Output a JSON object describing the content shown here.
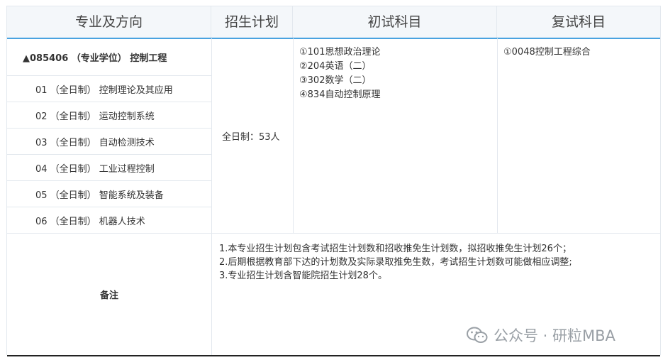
{
  "header": {
    "col1": "专业及方向",
    "col2": "招生计划",
    "col3": "初试科目",
    "col4": "复试科目"
  },
  "major": {
    "title": "▲085406 （专业学位） 控制工程"
  },
  "directions": [
    "01 （全日制） 控制理论及其应用",
    "02 （全日制） 运动控制系统",
    "03 （全日制） 自动检测技术",
    "04 （全日制） 工业过程控制",
    "05 （全日制） 智能系统及装备",
    "06 （全日制） 机器人技术"
  ],
  "plan": "全日制：53人",
  "exam_subjects": [
    "①101思想政治理论",
    "②204英语（二）",
    "③302数学（二）",
    "④834自动控制原理"
  ],
  "retest_subjects": [
    "①0048控制工程综合"
  ],
  "remarks": {
    "label": "备注",
    "lines": [
      "1.本专业招生计划包含考试招生计划数和招收推免生计划数，拟招收推免生计划26个；",
      "2.后期根据教育部下达的计划数及实际录取推免生数，考试招生计划数可能做相应调整;",
      "3.专业招生计划含智能院招生计划28个。"
    ]
  },
  "watermark": {
    "text": "公众号 · 研粒MBA",
    "icon": "wechat-icon"
  }
}
